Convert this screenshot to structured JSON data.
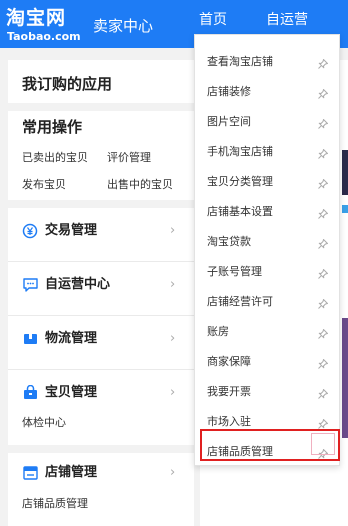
{
  "header": {
    "logo_cn": "淘宝网",
    "logo_en": "Taobao.com",
    "title": "卖家中心",
    "nav_home": "首页",
    "nav_self": "自运营"
  },
  "sidebar": {
    "subscribed_title": "我订购的应用",
    "common_title": "常用操作",
    "common_links": [
      "已卖出的宝贝",
      "评价管理",
      "发布宝贝",
      "出售中的宝贝"
    ],
    "items": [
      {
        "label": "交易管理",
        "icon": "yen-circle-icon"
      },
      {
        "label": "自运营中心",
        "icon": "chat-bubble-icon"
      },
      {
        "label": "物流管理",
        "icon": "box-icon"
      },
      {
        "label": "宝贝管理",
        "icon": "bag-icon"
      },
      {
        "label": "店铺管理",
        "icon": "store-icon"
      }
    ],
    "goods_sub": "体检中心",
    "store_sub": "店铺品质管理",
    "chevron": "›"
  },
  "dropdown": {
    "items": [
      "查看淘宝店铺",
      "店铺装修",
      "图片空间",
      "手机淘宝店铺",
      "宝贝分类管理",
      "店铺基本设置",
      "淘宝贷款",
      "子账号管理",
      "店铺经营许可",
      "账房",
      "商家保障",
      "我要开票",
      "市场入驻",
      "店铺品质管理"
    ],
    "pin_icon": "pin-icon",
    "highlighted": "店铺品质管理"
  },
  "colors": {
    "header_blue": "#1e7cf5",
    "icon_blue": "#1e7cf5",
    "highlight_red": "#e02020"
  }
}
